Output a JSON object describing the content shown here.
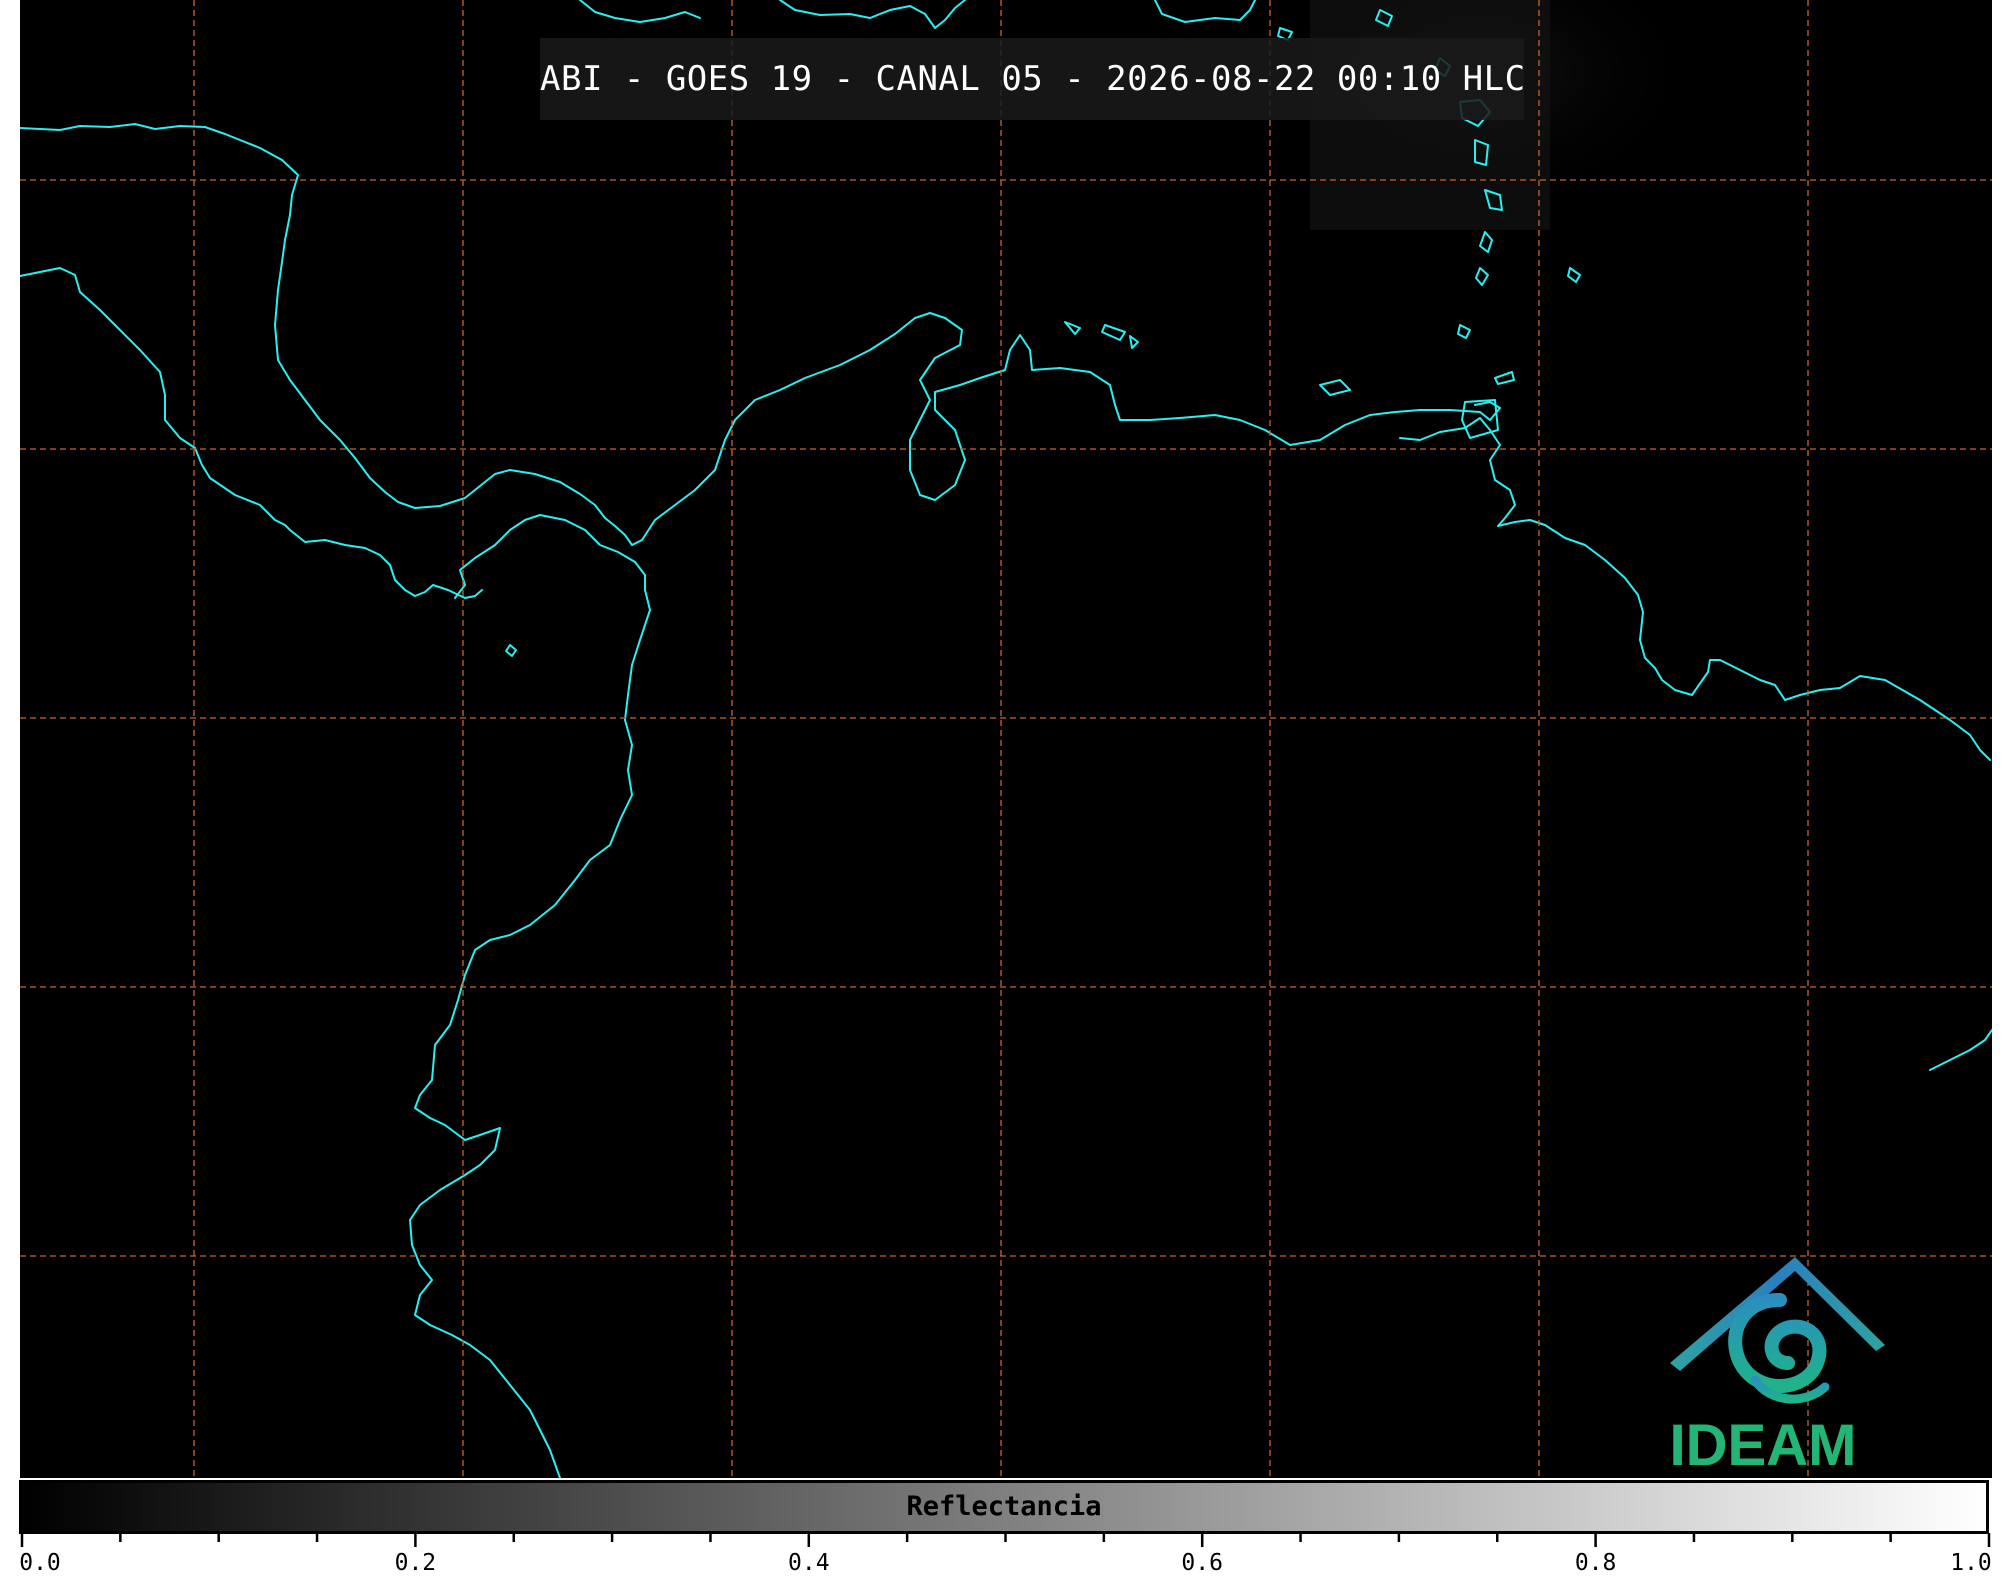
{
  "title": "ABI - GOES 19 - CANAL 05 - 2026-08-22 00:10 HLC",
  "colors": {
    "background": "#000000",
    "coastline": "#29f0f0",
    "gridline": "#c8642a",
    "title_text": "#ffffff",
    "logo_blue": "#2a7fbf",
    "logo_teal": "#1fb39a",
    "logo_green": "#23b575"
  },
  "colorbar": {
    "label": "Reflectancia",
    "min": 0.0,
    "max": 1.0,
    "colormap": "gray",
    "tick_labels": [
      "0.0",
      "0.2",
      "0.4",
      "0.6",
      "0.8",
      "1.0"
    ],
    "minor_tick_step": 0.05
  },
  "logo": {
    "text": "IDEAM"
  }
}
